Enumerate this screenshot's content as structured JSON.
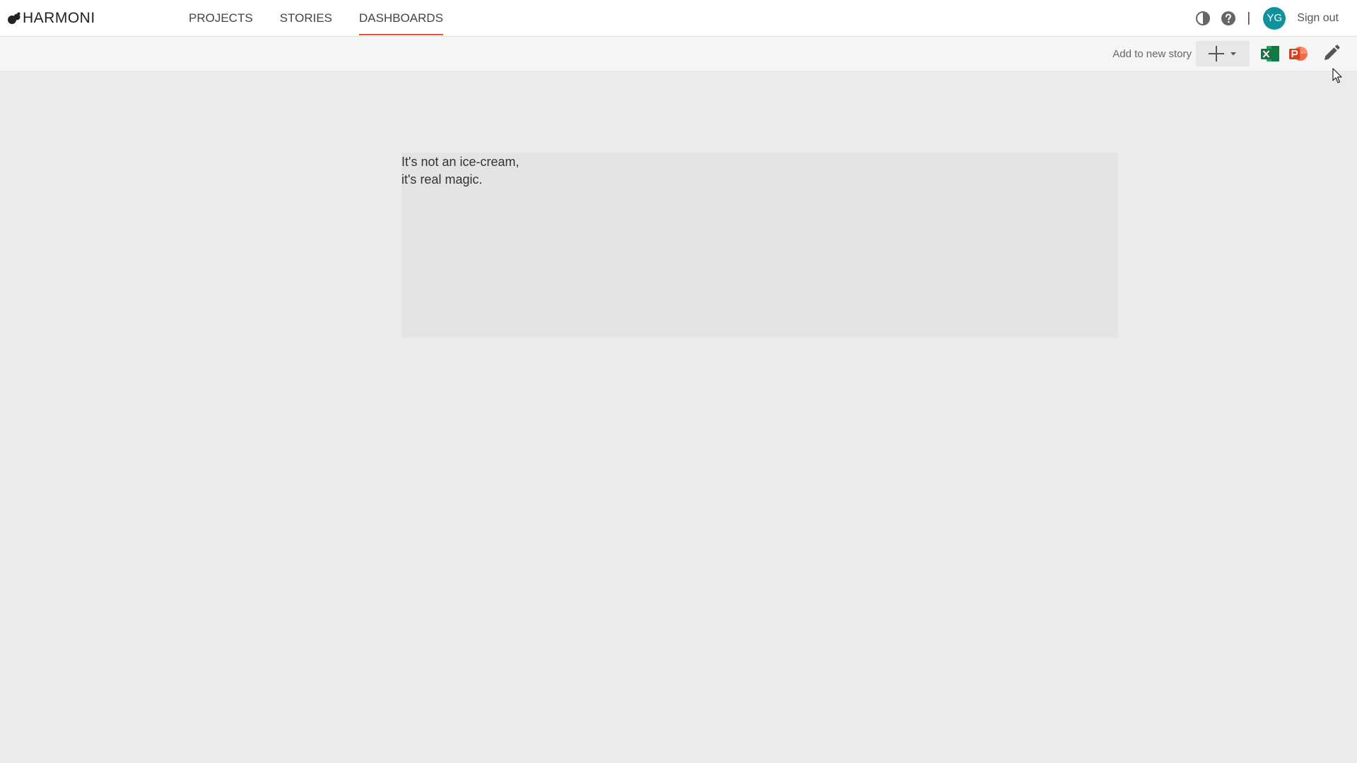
{
  "app": {
    "name": "HARMONI"
  },
  "nav": {
    "items": [
      {
        "label": "PROJECTS",
        "active": false
      },
      {
        "label": "STORIES",
        "active": false
      },
      {
        "label": "DASHBOARDS",
        "active": true
      }
    ]
  },
  "header": {
    "separator": "|",
    "avatar_initials": "YG",
    "sign_out_label": "Sign out",
    "icons": [
      "theme-contrast-icon",
      "help-icon"
    ]
  },
  "toolbar": {
    "add_to_story_label": "Add to new story",
    "icons": [
      "plus-icon",
      "dropdown-caret-icon",
      "excel-export-icon",
      "powerpoint-export-icon",
      "edit-pencil-icon"
    ]
  },
  "widget": {
    "lines": [
      "It's not an ice-cream,",
      "it's real magic."
    ]
  },
  "colors": {
    "accent": "#e2553b",
    "avatar": "#11919c",
    "excel": "#1e7145",
    "powerpoint": "#d04423",
    "background": "#ebebeb",
    "widget": "#e4e4e4"
  }
}
